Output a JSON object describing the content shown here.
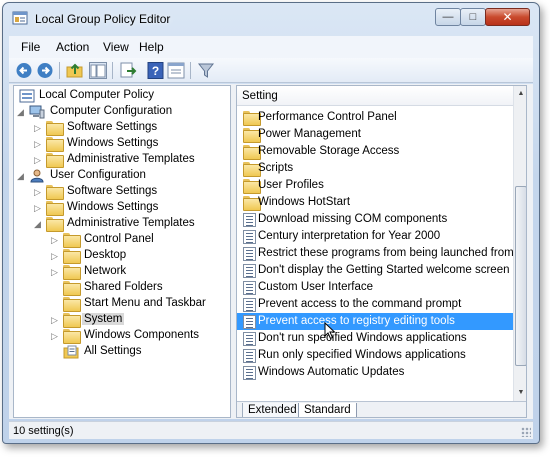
{
  "window": {
    "title": "Local Group Policy Editor",
    "controls": {
      "minimize": "—",
      "maximize": "□",
      "close": "✕"
    }
  },
  "menu": {
    "items": [
      "File",
      "Action",
      "View",
      "Help"
    ]
  },
  "toolbar": {
    "buttons": [
      "back-arrow-icon",
      "forward-arrow-icon",
      "up-folder-icon",
      "show-hide-tree-icon",
      "export-list-icon",
      "help-icon",
      "properties-icon",
      "filter-icon"
    ]
  },
  "tree": {
    "root": "Local Computer Policy",
    "computer_config": "Computer Configuration",
    "computer_children": [
      "Software Settings",
      "Windows Settings",
      "Administrative Templates"
    ],
    "user_config": "User Configuration",
    "user_children": [
      "Software Settings",
      "Windows Settings",
      "Administrative Templates"
    ],
    "admin_templates_children": [
      "Control Panel",
      "Desktop",
      "Network",
      "Shared Folders",
      "Start Menu and Taskbar",
      "System",
      "Windows Components",
      "All Settings"
    ],
    "selected": "System"
  },
  "settings_pane": {
    "column_header": "Setting",
    "items": [
      {
        "label": "Performance Control Panel",
        "type": "folder"
      },
      {
        "label": "Power Management",
        "type": "folder"
      },
      {
        "label": "Removable Storage Access",
        "type": "folder"
      },
      {
        "label": "Scripts",
        "type": "folder"
      },
      {
        "label": "User Profiles",
        "type": "folder"
      },
      {
        "label": "Windows HotStart",
        "type": "folder"
      },
      {
        "label": "Download missing COM components",
        "type": "setting"
      },
      {
        "label": "Century interpretation for Year 2000",
        "type": "setting"
      },
      {
        "label": "Restrict these programs from being launched from Hel",
        "type": "setting"
      },
      {
        "label": "Don't display the Getting Started welcome screen at lo",
        "type": "setting"
      },
      {
        "label": "Custom User Interface",
        "type": "setting"
      },
      {
        "label": "Prevent access to the command prompt",
        "type": "setting"
      },
      {
        "label": "Prevent access to registry editing tools",
        "type": "setting",
        "selected": true
      },
      {
        "label": "Don't run specified Windows applications",
        "type": "setting"
      },
      {
        "label": "Run only specified Windows applications",
        "type": "setting"
      },
      {
        "label": "Windows Automatic Updates",
        "type": "setting"
      }
    ],
    "tabs": [
      "Extended",
      "Standard"
    ],
    "active_tab": "Standard"
  },
  "status": {
    "text": "10 setting(s)"
  },
  "colors": {
    "selection": "#3399ff",
    "title_gradient": "#c4d6ec"
  }
}
